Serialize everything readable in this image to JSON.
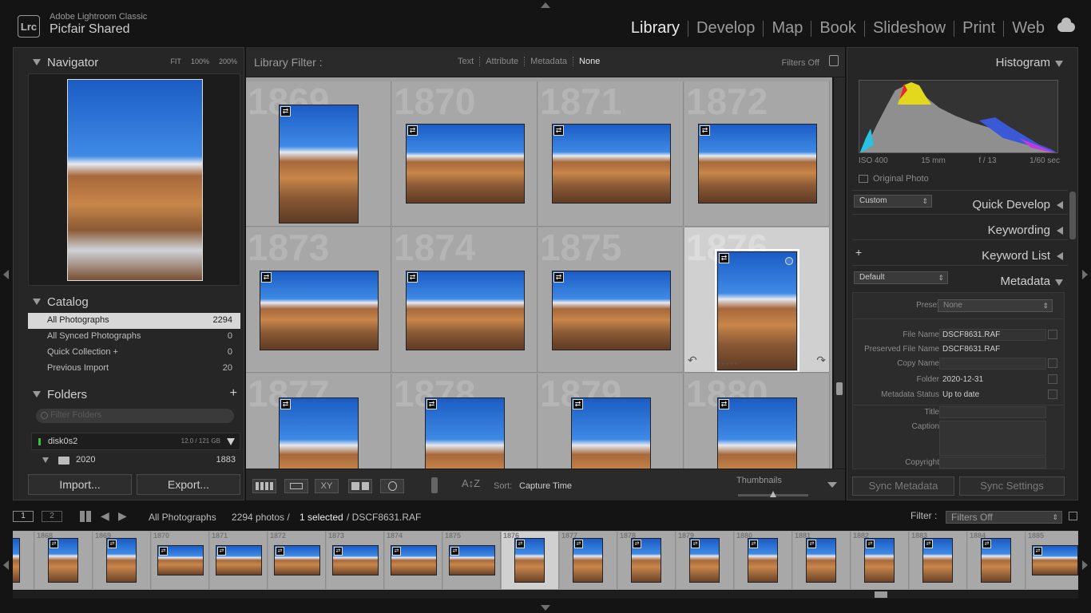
{
  "app": {
    "logo": "Lrc",
    "product": "Adobe Lightroom Classic",
    "catalog": "Picfair Shared"
  },
  "modules": [
    {
      "label": "Library",
      "active": true
    },
    {
      "label": "Develop"
    },
    {
      "label": "Map"
    },
    {
      "label": "Book"
    },
    {
      "label": "Slideshow"
    },
    {
      "label": "Print"
    },
    {
      "label": "Web"
    }
  ],
  "navigator": {
    "title": "Navigator",
    "options": [
      "FIT",
      "100%",
      "200%"
    ]
  },
  "catalog": {
    "title": "Catalog",
    "items": [
      {
        "label": "All Photographs",
        "count": "2294",
        "selected": true
      },
      {
        "label": "All Synced Photographs",
        "count": "0"
      },
      {
        "label": "Quick Collection +",
        "count": "0"
      },
      {
        "label": "Previous Import",
        "count": "20"
      }
    ]
  },
  "folders": {
    "title": "Folders",
    "filter_placeholder": "Filter Folders",
    "disk": {
      "name": "disk0s2",
      "size": "12.0 / 121 GB"
    },
    "folder": {
      "name": "2020",
      "count": "1883"
    }
  },
  "left_buttons": {
    "import": "Import...",
    "export": "Export..."
  },
  "library_filter": {
    "label": "Library Filter :",
    "options": [
      "Text",
      "Attribute",
      "Metadata",
      "None"
    ],
    "filters_off": "Filters Off"
  },
  "grid": {
    "cells": [
      "1869",
      "1870",
      "1871",
      "1872",
      "1873",
      "1874",
      "1875",
      "1876",
      "1877",
      "1878",
      "1879",
      "1880"
    ],
    "selected": "1876"
  },
  "toolbar": {
    "sort_label": "Sort:",
    "sort_value": "Capture Time",
    "thumbnails_label": "Thumbnails",
    "thumbnail_size": 0.5
  },
  "histogram": {
    "title": "Histogram",
    "iso": "ISO 400",
    "focal": "15 mm",
    "aperture": "f / 13",
    "shutter": "1/60 sec",
    "original_photo": "Original Photo"
  },
  "quick_develop": {
    "title": "Quick Develop",
    "preset": "Custom"
  },
  "keywording": {
    "title": "Keywording"
  },
  "keyword_list": {
    "title": "Keyword List"
  },
  "metadata": {
    "title": "Metadata",
    "set": "Default",
    "preset_label": "Preset",
    "preset_value": "None",
    "fields": [
      {
        "k": "File Name",
        "v": "DSCF8631.RAF"
      },
      {
        "k": "Preserved File Name",
        "v": "DSCF8631.RAF"
      },
      {
        "k": "Copy Name",
        "v": ""
      },
      {
        "k": "Folder",
        "v": "2020-12-31"
      },
      {
        "k": "Metadata Status",
        "v": "Up to date"
      },
      {
        "k": "Title",
        "v": ""
      },
      {
        "k": "Caption",
        "v": ""
      },
      {
        "k": "Copyright",
        "v": ""
      }
    ]
  },
  "right_buttons": {
    "sync_metadata": "Sync Metadata",
    "sync_settings": "Sync Settings"
  },
  "filmstrip_bar": {
    "screen1": "1",
    "screen2": "2",
    "source": "All Photographs",
    "count_text": "2294 photos /",
    "selected_text": "1 selected",
    "file_text": "/ DSCF8631.RAF",
    "filter_label": "Filter :",
    "filter_value": "Filters Off"
  },
  "filmstrip": {
    "items": [
      "1867",
      "1868",
      "1869",
      "1870",
      "1871",
      "1872",
      "1873",
      "1874",
      "1875",
      "1876",
      "1877",
      "1878",
      "1879",
      "1880",
      "1881",
      "1882",
      "1883",
      "1884",
      "1885"
    ],
    "selected": "1876"
  },
  "colors": {
    "accent_selected": "#d0d0d0",
    "panel": "#262626",
    "grid_bg": "#9e9e9e"
  }
}
